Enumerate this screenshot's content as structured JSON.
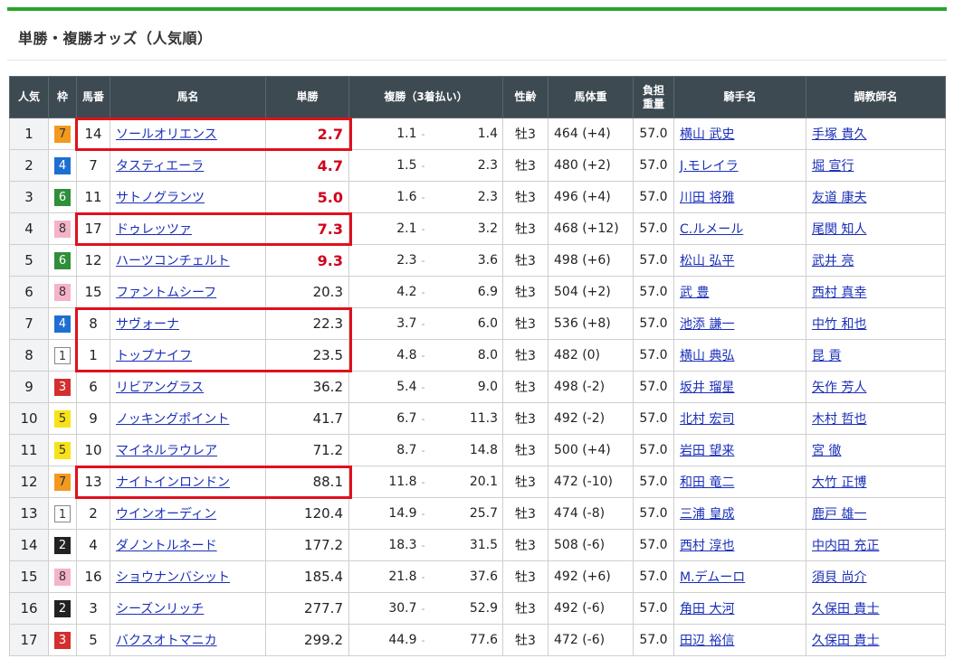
{
  "section_title": "単勝・複勝オッズ（人気順）",
  "headers": {
    "rank": "人気",
    "waku": "枠",
    "umaban": "馬番",
    "name": "馬名",
    "win": "単勝",
    "place": "複勝（3着払い）",
    "sex_age": "性齢",
    "body_weight": "馬体重",
    "jockey_weight_1": "負担",
    "jockey_weight_2": "重量",
    "jockey": "騎手名",
    "trainer": "調教師名"
  },
  "place_separator": "-",
  "colors": {
    "header_bg": "#3d4a52",
    "accent_green": "#2aa42a",
    "hot_odds": "#d0021b",
    "link": "#1a2fb8",
    "highlight_border": "#e0101d"
  },
  "waku_colors": {
    "1": {
      "bg": "#ffffff",
      "fg": "#333333"
    },
    "2": {
      "bg": "#222222",
      "fg": "#ffffff"
    },
    "3": {
      "bg": "#d32f2f",
      "fg": "#ffffff"
    },
    "4": {
      "bg": "#1e6fd1",
      "fg": "#ffffff"
    },
    "5": {
      "bg": "#f7e21a",
      "fg": "#333333"
    },
    "6": {
      "bg": "#2f8f3a",
      "fg": "#ffffff"
    },
    "7": {
      "bg": "#f29a1f",
      "fg": "#333333"
    },
    "8": {
      "bg": "#f5b3c8",
      "fg": "#333333"
    }
  },
  "rows": [
    {
      "rank": "1",
      "waku": "7",
      "umaban": "14",
      "name": "ソールオリエンス",
      "win": "2.7",
      "hot": true,
      "place_lo": "1.1",
      "place_hi": "1.4",
      "sex_age": "牡3",
      "body_weight": "464 (+4)",
      "jockey_weight": "57.0",
      "jockey": "横山 武史",
      "trainer": "手塚 貴久"
    },
    {
      "rank": "2",
      "waku": "4",
      "umaban": "7",
      "name": "タスティエーラ",
      "win": "4.7",
      "hot": true,
      "place_lo": "1.5",
      "place_hi": "2.3",
      "sex_age": "牡3",
      "body_weight": "480 (+2)",
      "jockey_weight": "57.0",
      "jockey": "J.モレイラ",
      "trainer": "堀 宣行"
    },
    {
      "rank": "3",
      "waku": "6",
      "umaban": "11",
      "name": "サトノグランツ",
      "win": "5.0",
      "hot": true,
      "place_lo": "1.6",
      "place_hi": "2.3",
      "sex_age": "牡3",
      "body_weight": "496 (+4)",
      "jockey_weight": "57.0",
      "jockey": "川田 将雅",
      "trainer": "友道 康夫"
    },
    {
      "rank": "4",
      "waku": "8",
      "umaban": "17",
      "name": "ドゥレッツァ",
      "win": "7.3",
      "hot": true,
      "place_lo": "2.1",
      "place_hi": "3.2",
      "sex_age": "牡3",
      "body_weight": "468 (+12)",
      "jockey_weight": "57.0",
      "jockey": "C.ルメール",
      "trainer": "尾関 知人"
    },
    {
      "rank": "5",
      "waku": "6",
      "umaban": "12",
      "name": "ハーツコンチェルト",
      "win": "9.3",
      "hot": true,
      "place_lo": "2.3",
      "place_hi": "3.6",
      "sex_age": "牡3",
      "body_weight": "498 (+6)",
      "jockey_weight": "57.0",
      "jockey": "松山 弘平",
      "trainer": "武井 亮"
    },
    {
      "rank": "6",
      "waku": "8",
      "umaban": "15",
      "name": "ファントムシーフ",
      "win": "20.3",
      "hot": false,
      "place_lo": "4.2",
      "place_hi": "6.9",
      "sex_age": "牡3",
      "body_weight": "504 (+2)",
      "jockey_weight": "57.0",
      "jockey": "武 豊",
      "trainer": "西村 真幸"
    },
    {
      "rank": "7",
      "waku": "4",
      "umaban": "8",
      "name": "サヴォーナ",
      "win": "22.3",
      "hot": false,
      "place_lo": "3.7",
      "place_hi": "6.0",
      "sex_age": "牡3",
      "body_weight": "536 (+8)",
      "jockey_weight": "57.0",
      "jockey": "池添 謙一",
      "trainer": "中竹 和也"
    },
    {
      "rank": "8",
      "waku": "1",
      "umaban": "1",
      "name": "トップナイフ",
      "win": "23.5",
      "hot": false,
      "place_lo": "4.8",
      "place_hi": "8.0",
      "sex_age": "牡3",
      "body_weight": "482 (0)",
      "jockey_weight": "57.0",
      "jockey": "横山 典弘",
      "trainer": "昆 貢"
    },
    {
      "rank": "9",
      "waku": "3",
      "umaban": "6",
      "name": "リビアングラス",
      "win": "36.2",
      "hot": false,
      "place_lo": "5.4",
      "place_hi": "9.0",
      "sex_age": "牡3",
      "body_weight": "498 (-2)",
      "jockey_weight": "57.0",
      "jockey": "坂井 瑠星",
      "trainer": "矢作 芳人"
    },
    {
      "rank": "10",
      "waku": "5",
      "umaban": "9",
      "name": "ノッキングポイント",
      "win": "41.7",
      "hot": false,
      "place_lo": "6.7",
      "place_hi": "11.3",
      "sex_age": "牡3",
      "body_weight": "492 (-2)",
      "jockey_weight": "57.0",
      "jockey": "北村 宏司",
      "trainer": "木村 哲也"
    },
    {
      "rank": "11",
      "waku": "5",
      "umaban": "10",
      "name": "マイネルラウレア",
      "win": "71.2",
      "hot": false,
      "place_lo": "8.7",
      "place_hi": "14.8",
      "sex_age": "牡3",
      "body_weight": "500 (+4)",
      "jockey_weight": "57.0",
      "jockey": "岩田 望来",
      "trainer": "宮 徹"
    },
    {
      "rank": "12",
      "waku": "7",
      "umaban": "13",
      "name": "ナイトインロンドン",
      "win": "88.1",
      "hot": false,
      "place_lo": "11.8",
      "place_hi": "20.1",
      "sex_age": "牡3",
      "body_weight": "472 (-10)",
      "jockey_weight": "57.0",
      "jockey": "和田 竜二",
      "trainer": "大竹 正博"
    },
    {
      "rank": "13",
      "waku": "1",
      "umaban": "2",
      "name": "ウインオーディン",
      "win": "120.4",
      "hot": false,
      "place_lo": "14.9",
      "place_hi": "25.7",
      "sex_age": "牡3",
      "body_weight": "474 (-8)",
      "jockey_weight": "57.0",
      "jockey": "三浦 皇成",
      "trainer": "鹿戸 雄一"
    },
    {
      "rank": "14",
      "waku": "2",
      "umaban": "4",
      "name": "ダノントルネード",
      "win": "177.2",
      "hot": false,
      "place_lo": "18.3",
      "place_hi": "31.5",
      "sex_age": "牡3",
      "body_weight": "508 (-6)",
      "jockey_weight": "57.0",
      "jockey": "西村 淳也",
      "trainer": "中内田 充正"
    },
    {
      "rank": "15",
      "waku": "8",
      "umaban": "16",
      "name": "ショウナンバシット",
      "win": "185.4",
      "hot": false,
      "place_lo": "21.8",
      "place_hi": "37.6",
      "sex_age": "牡3",
      "body_weight": "492 (+6)",
      "jockey_weight": "57.0",
      "jockey": "M.デムーロ",
      "trainer": "須貝 尚介"
    },
    {
      "rank": "16",
      "waku": "2",
      "umaban": "3",
      "name": "シーズンリッチ",
      "win": "277.7",
      "hot": false,
      "place_lo": "30.7",
      "place_hi": "52.9",
      "sex_age": "牡3",
      "body_weight": "492 (-6)",
      "jockey_weight": "57.0",
      "jockey": "角田 大河",
      "trainer": "久保田 貴士"
    },
    {
      "rank": "17",
      "waku": "3",
      "umaban": "5",
      "name": "バクスオトマニカ",
      "win": "299.2",
      "hot": false,
      "place_lo": "44.9",
      "place_hi": "77.6",
      "sex_age": "牡3",
      "body_weight": "472 (-6)",
      "jockey_weight": "57.0",
      "jockey": "田辺 裕信",
      "trainer": "久保田 貴士"
    }
  ]
}
